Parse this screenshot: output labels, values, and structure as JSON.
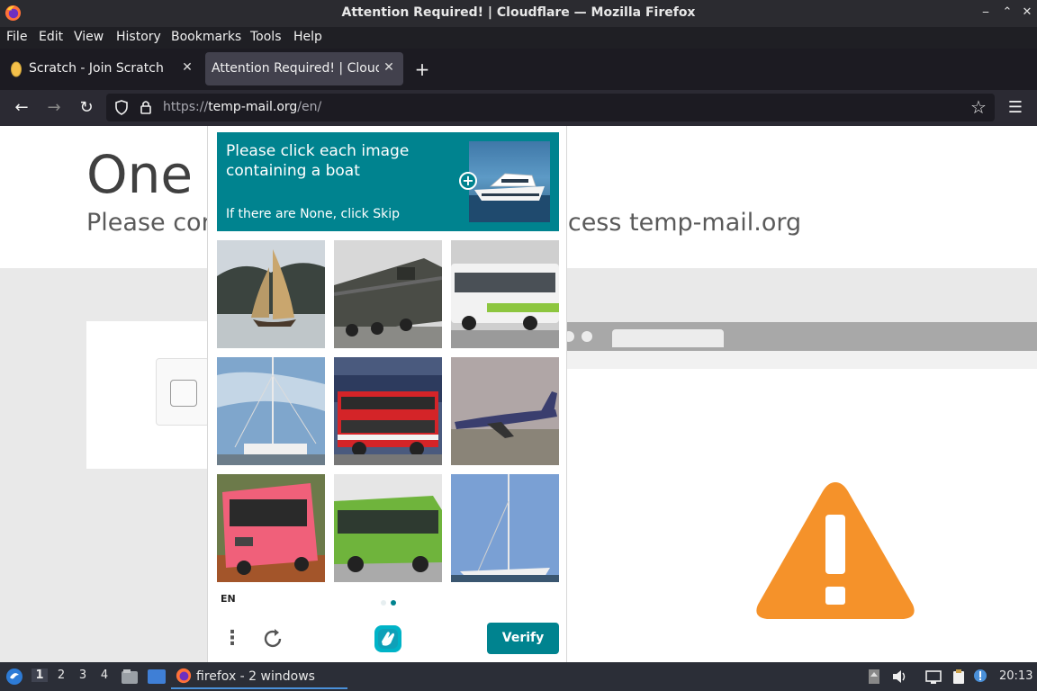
{
  "window": {
    "title": "Attention Required! | Cloudflare — Mozilla Firefox",
    "minimize": "⎯",
    "maximize": "⌃",
    "close": "✕"
  },
  "menu": [
    "File",
    "Edit",
    "View",
    "History",
    "Bookmarks",
    "Tools",
    "Help"
  ],
  "tabs": [
    {
      "label": "Scratch - Join Scratch",
      "icon": "scratch-icon",
      "active": false
    },
    {
      "label": "Attention Required! | Cloudfl",
      "icon": "none",
      "active": true
    }
  ],
  "navbar": {
    "url_prefix": "https://",
    "url_host": "temp-mail.org",
    "url_path": "/en/"
  },
  "page": {
    "headline": "One m",
    "subline": "Please com",
    "subline_tail": "ccess temp-mail.org"
  },
  "captcha": {
    "prompt": "Please click each image containing a boat",
    "sub": "If there are None, click Skip",
    "language": "EN",
    "verify_label": "Verify",
    "menu_glyph": "⋮",
    "images": [
      {
        "subject": "sailboat",
        "selected": false
      },
      {
        "subject": "train",
        "selected": false
      },
      {
        "subject": "bus",
        "selected": false
      },
      {
        "subject": "sailboat-mast",
        "selected": false
      },
      {
        "subject": "double-decker-bus",
        "selected": false
      },
      {
        "subject": "airplane",
        "selected": false
      },
      {
        "subject": "pink-bus",
        "selected": false
      },
      {
        "subject": "green-bus",
        "selected": false
      },
      {
        "subject": "sailboat-sky",
        "selected": false
      }
    ],
    "page_dots": 2,
    "active_dot": 1,
    "accent": "#00838f"
  },
  "taskbar": {
    "workspaces": [
      "1",
      "2",
      "3",
      "4"
    ],
    "active_workspace": 0,
    "task_label": "firefox - 2 windows",
    "clock": "20:13"
  },
  "colors": {
    "warning": "#f5922a",
    "titlebar": "#2b2b30"
  }
}
